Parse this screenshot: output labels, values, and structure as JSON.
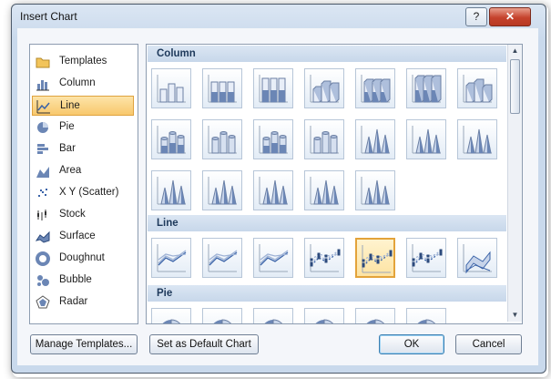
{
  "dialog": {
    "title": "Insert Chart",
    "help_label": "?",
    "close_label": "✕"
  },
  "categories": [
    {
      "label": "Templates",
      "icon": "folder-icon"
    },
    {
      "label": "Column",
      "icon": "column-chart-icon"
    },
    {
      "label": "Line",
      "icon": "line-chart-icon",
      "selected": true
    },
    {
      "label": "Pie",
      "icon": "pie-chart-icon"
    },
    {
      "label": "Bar",
      "icon": "bar-chart-icon"
    },
    {
      "label": "Area",
      "icon": "area-chart-icon"
    },
    {
      "label": "X Y (Scatter)",
      "icon": "scatter-chart-icon"
    },
    {
      "label": "Stock",
      "icon": "stock-chart-icon"
    },
    {
      "label": "Surface",
      "icon": "surface-chart-icon"
    },
    {
      "label": "Doughnut",
      "icon": "doughnut-chart-icon"
    },
    {
      "label": "Bubble",
      "icon": "bubble-chart-icon"
    },
    {
      "label": "Radar",
      "icon": "radar-chart-icon"
    }
  ],
  "groups": [
    {
      "label": "Column",
      "tiles": [
        {
          "icon": "clustered-column-icon"
        },
        {
          "icon": "stacked-column-icon"
        },
        {
          "icon": "100-stacked-column-icon"
        },
        {
          "icon": "3d-clustered-column-icon"
        },
        {
          "icon": "3d-stacked-column-icon"
        },
        {
          "icon": "3d-100-stacked-column-icon"
        },
        {
          "icon": "3d-column-icon"
        },
        {
          "icon": "clustered-cylinder-icon"
        },
        {
          "icon": "stacked-cylinder-icon"
        },
        {
          "icon": "100-stacked-cylinder-icon"
        },
        {
          "icon": "3d-cylinder-icon"
        },
        {
          "icon": "clustered-cone-icon"
        },
        {
          "icon": "stacked-cone-icon"
        },
        {
          "icon": "100-stacked-cone-icon"
        },
        {
          "icon": "3d-cone-icon"
        },
        {
          "icon": "clustered-pyramid-icon"
        },
        {
          "icon": "stacked-pyramid-icon"
        },
        {
          "icon": "100-stacked-pyramid-icon"
        },
        {
          "icon": "3d-pyramid-icon"
        }
      ]
    },
    {
      "label": "Line",
      "tiles": [
        {
          "icon": "line-icon"
        },
        {
          "icon": "stacked-line-icon"
        },
        {
          "icon": "100-stacked-line-icon"
        },
        {
          "icon": "line-with-markers-icon"
        },
        {
          "icon": "stacked-line-with-markers-icon",
          "selected": true
        },
        {
          "icon": "100-stacked-line-with-markers-icon"
        },
        {
          "icon": "3d-line-icon"
        }
      ]
    },
    {
      "label": "Pie",
      "tiles": [
        {
          "icon": "pie-icon"
        },
        {
          "icon": "3d-pie-icon"
        },
        {
          "icon": "pie-of-pie-icon"
        },
        {
          "icon": "exploded-pie-icon"
        },
        {
          "icon": "exploded-3d-pie-icon"
        },
        {
          "icon": "bar-of-pie-icon"
        }
      ]
    }
  ],
  "buttons": {
    "manage_templates": "Manage Templates...",
    "set_default": "Set as Default Chart",
    "ok": "OK",
    "cancel": "Cancel"
  },
  "colors": {
    "selection_fill": "#f8c86c",
    "selection_border": "#dfa23e",
    "group_header_text": "#1e395b",
    "chart_blue": "#6b86b5"
  }
}
